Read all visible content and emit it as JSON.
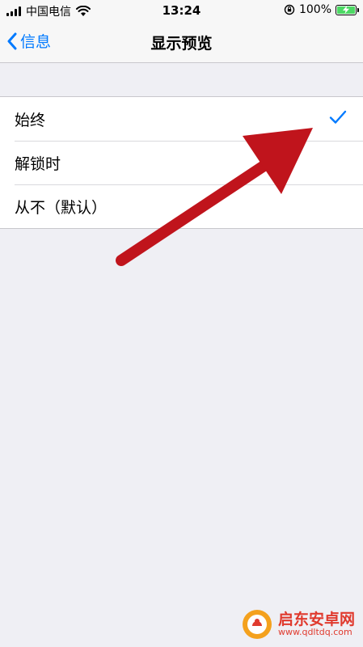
{
  "status_bar": {
    "carrier": "中国电信",
    "time": "13:24",
    "battery_percent": "100%",
    "battery_level": 1.0
  },
  "nav": {
    "back_label": "信息",
    "title": "显示预览"
  },
  "options": [
    {
      "label": "始终",
      "selected": true
    },
    {
      "label": "解锁时",
      "selected": false
    },
    {
      "label": "从不（默认）",
      "selected": false
    }
  ],
  "colors": {
    "accent": "#007aff",
    "arrow": "#c0141c",
    "battery": "#4cd964"
  },
  "watermark": {
    "name": "启东安卓网",
    "url": "www.qdltdq.com"
  }
}
